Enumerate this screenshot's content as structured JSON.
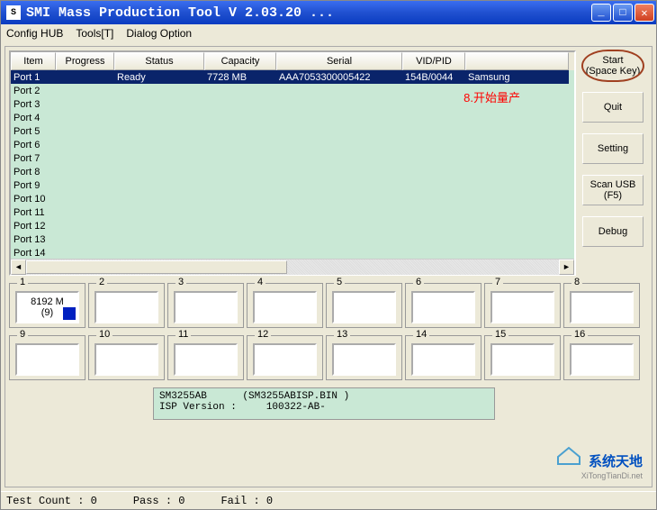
{
  "title": "SMI Mass Production Tool         V 2.03.20  ...",
  "menu": {
    "config": "Config HUB",
    "tools": "Tools[T]",
    "dialog": "Dialog Option"
  },
  "columns": [
    "Item",
    "Progress",
    "Status",
    "Capacity",
    "Serial",
    "VID/PID",
    ""
  ],
  "rows": [
    {
      "item": "Port 1",
      "progress": "",
      "status": "Ready",
      "capacity": "7728 MB",
      "serial": "AAA7053300005422",
      "vidpid": "154B/0044",
      "extra": "Samsung",
      "selected": true
    },
    {
      "item": "Port 2"
    },
    {
      "item": "Port 3"
    },
    {
      "item": "Port 4"
    },
    {
      "item": "Port 5"
    },
    {
      "item": "Port 6"
    },
    {
      "item": "Port 7"
    },
    {
      "item": "Port 8"
    },
    {
      "item": "Port 9"
    },
    {
      "item": "Port 10"
    },
    {
      "item": "Port 11"
    },
    {
      "item": "Port 12"
    },
    {
      "item": "Port 13"
    },
    {
      "item": "Port 14"
    }
  ],
  "annotation": "8.开始量产",
  "buttons": {
    "start_l1": "Start",
    "start_l2": "(Space Key)",
    "quit": "Quit",
    "setting": "Setting",
    "scan_l1": "Scan USB",
    "scan_l2": "(F5)",
    "debug": "Debug"
  },
  "slots": [
    {
      "n": "1",
      "val": "8192 M\n(9)",
      "blue": true
    },
    {
      "n": "2"
    },
    {
      "n": "3"
    },
    {
      "n": "4"
    },
    {
      "n": "5"
    },
    {
      "n": "6"
    },
    {
      "n": "7"
    },
    {
      "n": "8"
    },
    {
      "n": "9"
    },
    {
      "n": "10"
    },
    {
      "n": "11"
    },
    {
      "n": "12"
    },
    {
      "n": "13"
    },
    {
      "n": "14"
    },
    {
      "n": "15"
    },
    {
      "n": "16"
    }
  ],
  "info": "SM3255AB      (SM3255ABISP.BIN )\nISP Version :     100322-AB-",
  "status": {
    "test": "Test Count : 0",
    "pass": "Pass : 0",
    "fail": "Fail : 0"
  },
  "logo": {
    "cn": "系统天地",
    "en": "XiTongTianDi.net"
  }
}
